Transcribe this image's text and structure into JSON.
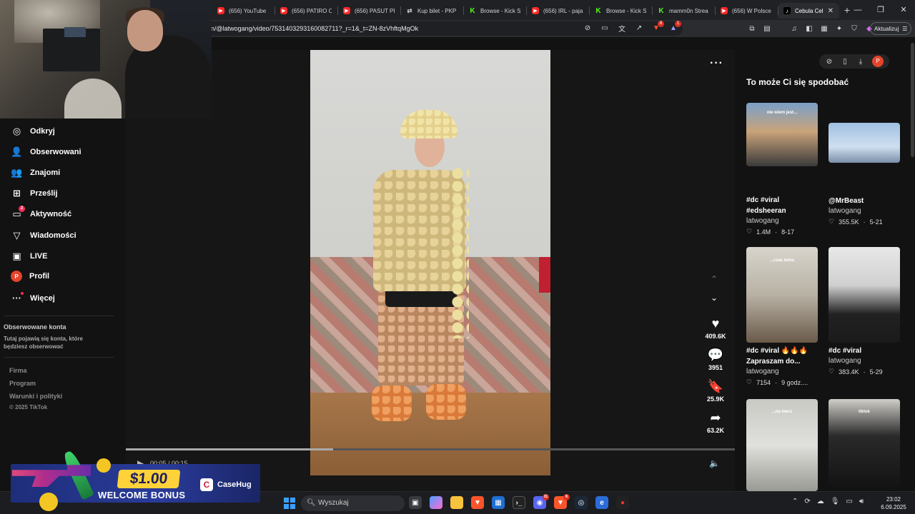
{
  "browser": {
    "tabs": [
      {
        "label": "(656) YouTube",
        "icon": "youtube-icon"
      },
      {
        "label": "(656) PATIRO C",
        "icon": "youtube-icon"
      },
      {
        "label": "(656) PASUT PR",
        "icon": "youtube-icon"
      },
      {
        "label": "Kup bilet - PKP",
        "icon": "ticket-icon"
      },
      {
        "label": "Browse - Kick S",
        "icon": "kick-icon"
      },
      {
        "label": "(656) IRL - paja",
        "icon": "youtube-icon"
      },
      {
        "label": "Browse - Kick S",
        "icon": "kick-icon"
      },
      {
        "label": "mamm0n Strea",
        "icon": "kick-icon"
      },
      {
        "label": "(656) W Polsce",
        "icon": "youtube-icon"
      },
      {
        "label": "Cebula Cel",
        "icon": "tiktok-icon",
        "active": true
      }
    ],
    "url": "n/@latwogang/video/7531403293160082711?_r=1&_t=ZN-8zVhftqMgOk",
    "update_label": "Aktualizuj",
    "extension_badges": {
      "brave": "8",
      "alert": "1"
    }
  },
  "sidebar": {
    "items": [
      {
        "label": "Odkryj",
        "icon": "compass-icon",
        "glyph": "◎"
      },
      {
        "label": "Obserwowani",
        "icon": "following-icon",
        "glyph": "👤"
      },
      {
        "label": "Znajomi",
        "icon": "friends-icon",
        "glyph": "👥"
      },
      {
        "label": "Prześlij",
        "icon": "upload-icon",
        "glyph": "⊞"
      },
      {
        "label": "Aktywność",
        "icon": "activity-icon",
        "glyph": "▭",
        "badge": "2"
      },
      {
        "label": "Wiadomości",
        "icon": "messages-icon",
        "glyph": "▽"
      },
      {
        "label": "LIVE",
        "icon": "live-icon",
        "glyph": "▣"
      },
      {
        "label": "Profil",
        "icon": "profile-icon",
        "glyph": "P"
      },
      {
        "label": "Więcej",
        "icon": "more-icon",
        "glyph": "···"
      }
    ],
    "followed_title": "Obserwowane konta",
    "followed_desc": "Tutaj pojawią się konta, które będziesz obserwować",
    "footer_links": [
      "Firma",
      "Program",
      "Warunki i polityki"
    ],
    "copyright": "© 2025 TikTok"
  },
  "ad": {
    "amount": "$1.00",
    "bonus": "WELCOME BONUS",
    "brand": "CaseHug"
  },
  "video": {
    "actions": [
      {
        "icon": "heart-icon",
        "glyph": "♥",
        "count": "409.6K"
      },
      {
        "icon": "comment-icon",
        "glyph": "💬",
        "count": "3951"
      },
      {
        "icon": "bookmark-icon",
        "glyph": "🔖",
        "count": "25.9K"
      },
      {
        "icon": "share-icon",
        "glyph": "➦",
        "count": "63.2K"
      }
    ],
    "time": "00:05 / 00:15",
    "progress": 0.34
  },
  "recommendations": {
    "title": "To może Ci się spodobać",
    "cards": [
      {
        "title_lines": [
          "#dc #viral",
          "#edsheeran"
        ],
        "author": "latwogang",
        "likes": "1.4M",
        "date": "8-17",
        "thumb_text": "nie wiem jest..."
      },
      {
        "title_lines": [
          "@MrBeast"
        ],
        "author": "latwogang",
        "likes": "355.5K",
        "date": "5-21",
        "thumb_text": ""
      },
      {
        "title_lines": [
          "#dc #viral 🔥🔥🔥",
          "Zapraszam do..."
        ],
        "author": "latwogang",
        "likes": "7154",
        "date": "9 godz....",
        "thumb_text": "...czas temu"
      },
      {
        "title_lines": [
          "#dc #viral"
        ],
        "author": "latwogang",
        "likes": "383.4K",
        "date": "5-29",
        "thumb_text": ""
      },
      {
        "title_lines": [],
        "author": "",
        "likes": "",
        "date": "",
        "thumb_text": "...na mecz"
      },
      {
        "title_lines": [],
        "author": "",
        "likes": "",
        "date": "",
        "thumb_text": "tiktok"
      }
    ]
  },
  "taskbar": {
    "search_placeholder": "Wyszukaj",
    "time": "23:02",
    "date": "6.09.2025"
  }
}
